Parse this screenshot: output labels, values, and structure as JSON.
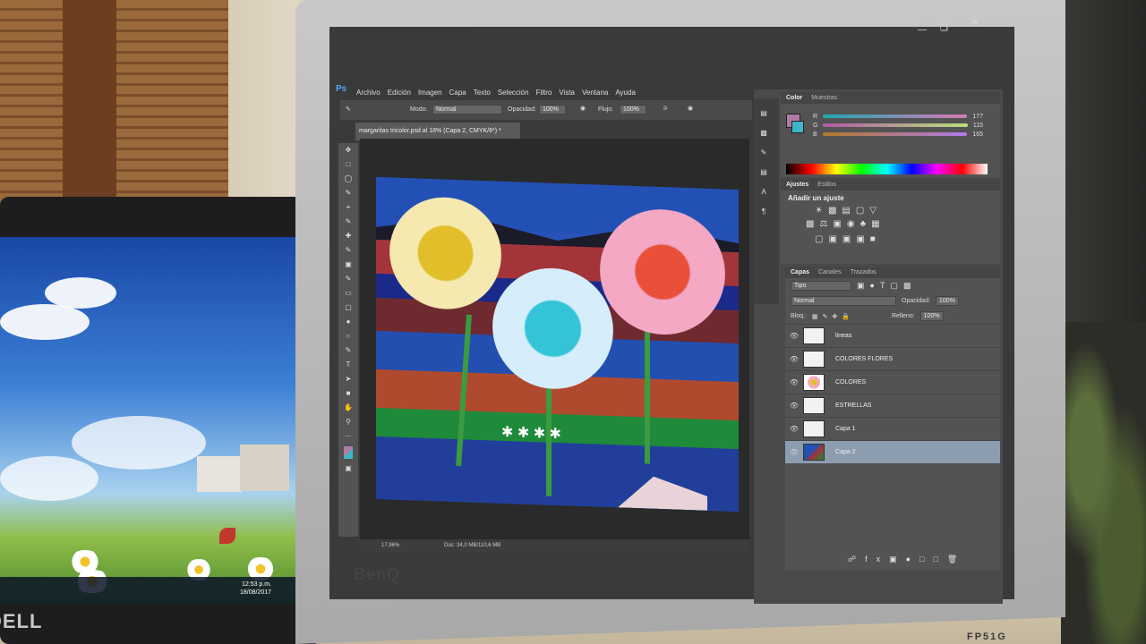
{
  "photoshop": {
    "logo": "Ps",
    "menu": [
      "Archivo",
      "Edición",
      "Imagen",
      "Capa",
      "Texto",
      "Selección",
      "Filtro",
      "Vista",
      "Ventana",
      "Ayuda"
    ],
    "options": {
      "modo_label": "Modo:",
      "modo_value": "Normal",
      "opacidad_label": "Opacidad:",
      "opacidad_value": "100%",
      "flujo_label": "Flujo:",
      "flujo_value": "100%"
    },
    "document_tab": "margaritas tricolor.psd al 18% (Capa 2, CMYK/8*) *",
    "status": {
      "zoom": "17,96%",
      "doc": "Doc: 34,0 MB/110,6 MB"
    },
    "color_panel": {
      "tabs": [
        "Color",
        "Muestras"
      ],
      "channels": [
        {
          "label": "R",
          "value": "177"
        },
        {
          "label": "G",
          "value": "115"
        },
        {
          "label": "B",
          "value": "165"
        }
      ]
    },
    "adjust_panel": {
      "tabs": [
        "Ajustes",
        "Estilos"
      ],
      "heading": "Añadir un ajuste"
    },
    "layers_panel": {
      "tabs": [
        "Capas",
        "Canales",
        "Trazados"
      ],
      "filter": "Tipo",
      "blend": "Normal",
      "opacity_label": "Opacidad:",
      "opacity_value": "100%",
      "lock_label": "Bloq.:",
      "fill_label": "Relleno:",
      "fill_value": "100%",
      "layers": [
        "lineas",
        "COLORES FLORES",
        "COLORES",
        "ESTRELLAS",
        "Capa 1",
        "Capa 2"
      ],
      "selected_layer": "Capa 2"
    }
  },
  "laptop": {
    "clock_time": "12:53 p.m.",
    "clock_date": "18/08/2017",
    "brand": "DELL"
  },
  "monitor": {
    "brand": "BenQ",
    "model": "FP51G"
  },
  "colors": {
    "ps_dark": "#3a3a3a",
    "ps_panel": "#535353",
    "selected_layer": "#8c9db0",
    "painting_blue": "#2752b8"
  }
}
